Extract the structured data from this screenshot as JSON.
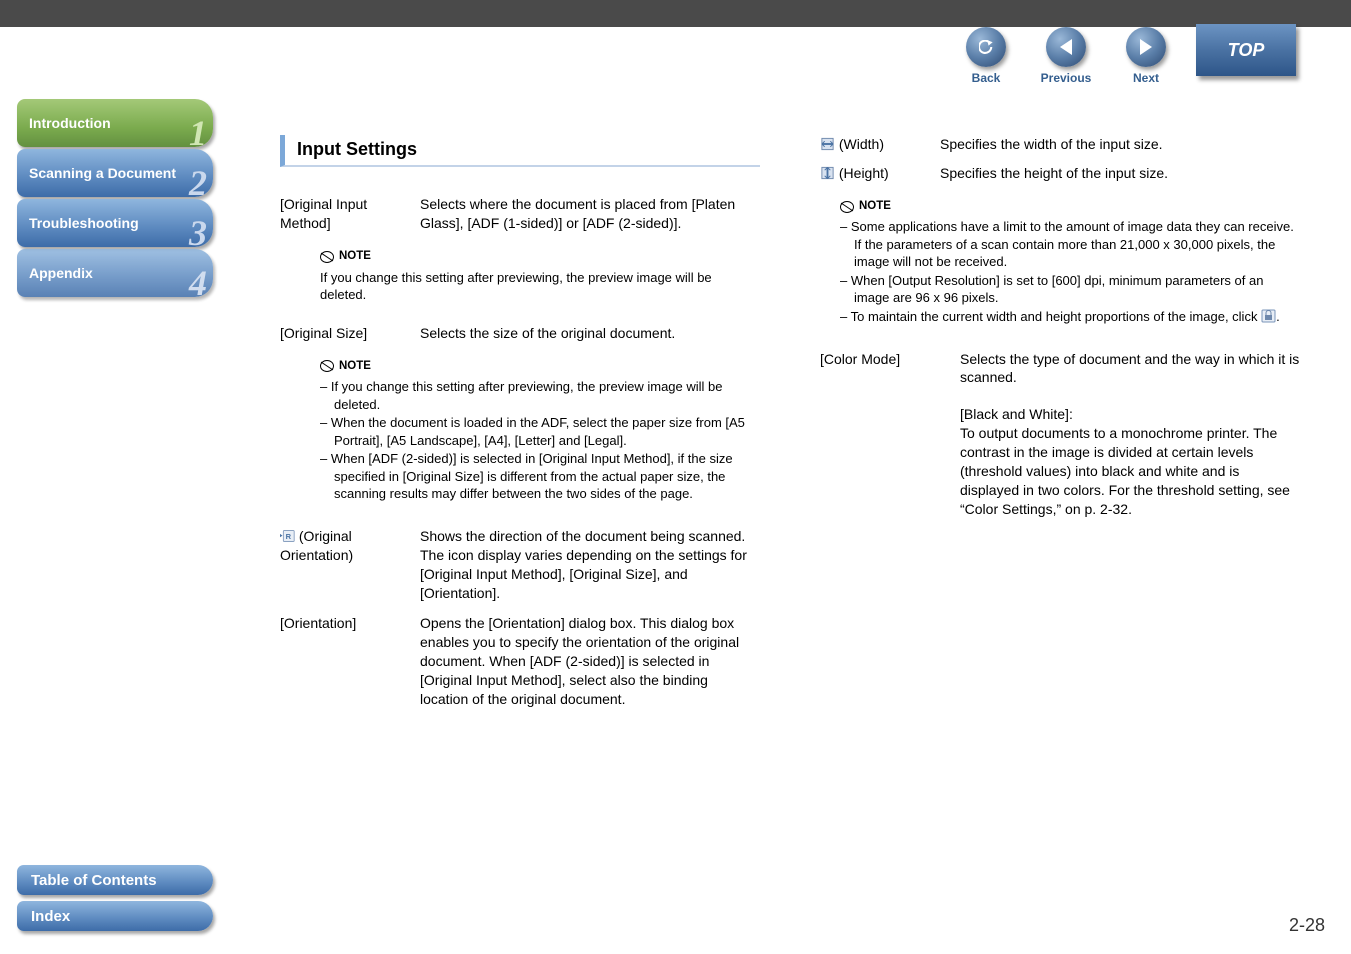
{
  "nav": {
    "back": "Back",
    "prev": "Previous",
    "next": "Next",
    "top": "TOP"
  },
  "sidebar": {
    "intro": "Introduction",
    "scan": "Scanning a Document",
    "trouble": "Troubleshooting",
    "appendix": "Appendix",
    "n1": "1",
    "n2": "2",
    "n3": "3",
    "n4": "4"
  },
  "bottom": {
    "toc": "Table of Contents",
    "index": "Index"
  },
  "content": {
    "heading": "Input Settings",
    "row1_term": "[Original Input Method]",
    "row1_desc": "Selects where the document is placed from [Platen Glass], [ADF (1-sided)] or [ADF (2-sided)].",
    "note1_label": "NOTE",
    "note1_text": "If you change this setting after previewing, the preview image will be deleted.",
    "row2_term": "[Original Size]",
    "row2_desc": "Selects the size of the original document.",
    "note2_label": "NOTE",
    "note2_items": [
      "– If you change this setting after previewing, the preview image will be deleted.",
      "– When the document is loaded in the ADF, select the paper size from [A5 Portrait], [A5 Landscape], [A4], [Letter] and [Legal].",
      "– When [ADF (2-sided)] is selected in [Original Input Method], if the size specified in [Original Size] is different from the actual paper size, the scanning results may differ between the two sides of the page."
    ],
    "row3_term": " (Original Orientation)",
    "row3_desc": "Shows the direction of the document being scanned. The icon display varies depending on the settings for [Original Input Method], [Original Size], and [Orientation].",
    "row4_term": "[Orientation]",
    "row4_desc": "Opens the [Orientation] dialog box. This dialog box enables you to specify the orientation of the original document. When [ADF (2-sided)] is selected in [Original Input Method], select also the binding location of the original document.",
    "rowW_term": " (Width)",
    "rowW_desc": "Specifies the width of the input size.",
    "rowH_term": " (Height)",
    "rowH_desc": "Specifies the height of the input size.",
    "note3_label": "NOTE",
    "note3_items": [
      "– Some applications have a limit to the amount of image data they can receive. If the parameters of a scan contain more than 21,000 x 30,000 pixels, the image will not be received.",
      "– When [Output Resolution] is set to [600] dpi, minimum parameters of an image are 96 x 96 pixels.",
      "– To maintain the current width and height proportions of the image, click "
    ],
    "note3_tail": ".",
    "row5_term": "[Color Mode]",
    "row5_desc": "Selects the type of document and the way in which it is scanned.",
    "row5_sub_title": "[Black and White]:",
    "row5_sub_desc": "To output documents to a monochrome printer. The contrast in the image is divided at certain levels (threshold values) into black and white and is displayed in two colors. For the threshold setting, see “Color Settings,” on p. 2-32."
  },
  "page_num": "2-28"
}
